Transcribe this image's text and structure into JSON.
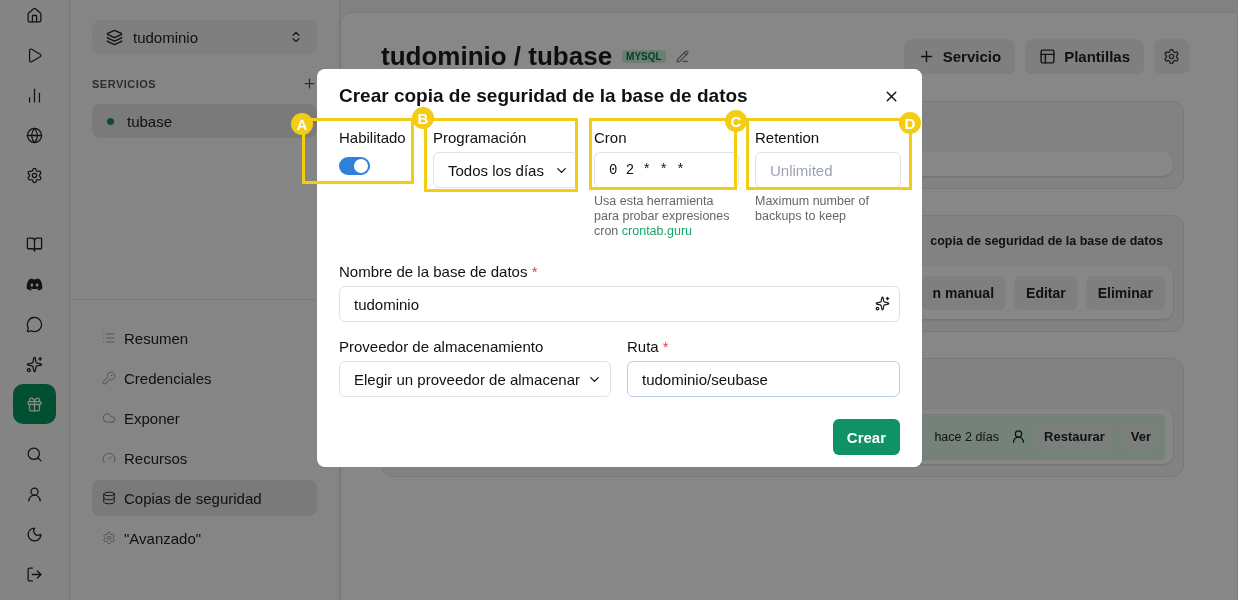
{
  "rail": {
    "items": [
      {
        "selected": false
      },
      {
        "selected": false
      },
      {
        "selected": false
      },
      {
        "selected": false
      },
      {
        "selected": false
      },
      {
        "selected": false
      },
      {
        "selected": false
      },
      {
        "selected": false
      },
      {
        "selected": false
      },
      {
        "selected": true
      },
      {
        "selected": false
      },
      {
        "selected": false
      },
      {
        "selected": false
      },
      {
        "selected": false
      }
    ]
  },
  "sidebar": {
    "workspace": "tudominio",
    "services_heading": "SERVICIOS",
    "services": [
      {
        "name": "tubase",
        "selected": true
      }
    ],
    "nav": [
      {
        "label": "Resumen",
        "selected": false
      },
      {
        "label": "Credenciales",
        "selected": false
      },
      {
        "label": "Exponer",
        "selected": false
      },
      {
        "label": "Recursos",
        "selected": false
      },
      {
        "label": "Copias de seguridad",
        "selected": true
      },
      {
        "label": "\"Avanzado\"",
        "selected": false
      }
    ]
  },
  "main": {
    "title": "tudominio / tubase",
    "badge": "MYSQL",
    "actions": [
      {
        "label": "Servicio"
      },
      {
        "label": "Plantillas"
      }
    ],
    "backup_card": {
      "title": "copia de seguridad de la base de datos",
      "buttons": [
        "n manual",
        "Editar",
        "Eliminar"
      ]
    },
    "backups": {
      "rows": [
        {
          "time": "hace 2 días",
          "buttons": [
            "Restaurar",
            "Ver"
          ]
        }
      ]
    }
  },
  "dialog": {
    "title": "Crear copia de seguridad de la base de datos",
    "enabled": {
      "label": "Habilitado",
      "on": true,
      "callout": "A"
    },
    "schedule": {
      "label": "Programación",
      "value": "Todos los días",
      "callout": "B"
    },
    "cron": {
      "label": "Cron",
      "value": "0 2 * * *",
      "callout": "C",
      "help": "Usa esta herramienta para probar expresiones cron",
      "help_link": "crontab.guru"
    },
    "retention": {
      "label": "Retention",
      "placeholder": "Unlimited",
      "callout": "D",
      "help": "Maximum number of backups to keep"
    },
    "database_name": {
      "label": "Nombre de la base de datos",
      "required": "*",
      "value": "tudominio"
    },
    "storage_provider": {
      "label": "Proveedor de almacenamiento",
      "value": "Elegir un proveedor de almacenar"
    },
    "path": {
      "label": "Ruta",
      "required": "*",
      "value": "tudominio/seubase"
    },
    "submit": "Crear"
  }
}
